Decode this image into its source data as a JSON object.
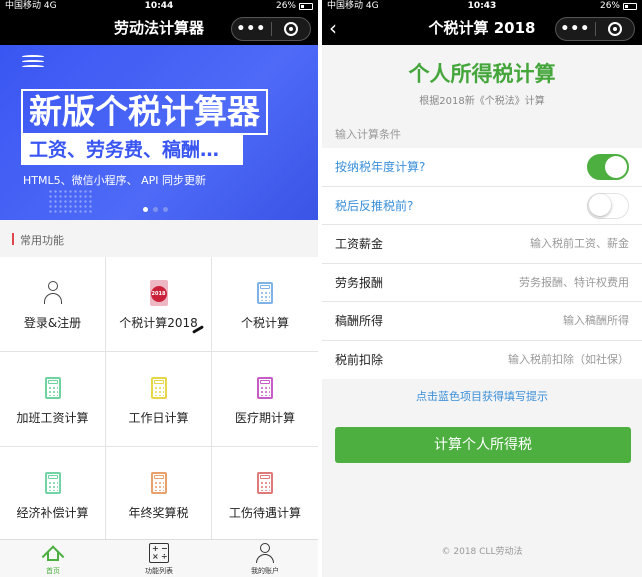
{
  "left": {
    "status": {
      "carrier": "中国移动  4G",
      "time": "10:44",
      "battery": "26%"
    },
    "nav": {
      "title": "劳动法计算器",
      "more": "•••"
    },
    "banner": {
      "headline": "新版个税计算器",
      "subline": "工资、劳务费、稿酬…",
      "tagline": "HTML5、微信小程序、 API 同步更新",
      "page_count": 3,
      "active_page": 1
    },
    "section_label": "常用功能",
    "grid": [
      {
        "label": "登录&注册",
        "icon": "user-icon",
        "color": "#444444"
      },
      {
        "label": "个税计算2018",
        "icon": "tax-2018-icon",
        "color": "#c9223a",
        "badge": "2018"
      },
      {
        "label": "个税计算",
        "icon": "calculator-icon",
        "color": "#7fb3e8"
      },
      {
        "label": "加班工资计算",
        "icon": "calculator-icon",
        "color": "#6fd3a0"
      },
      {
        "label": "工作日计算",
        "icon": "calculator-icon",
        "color": "#e6d74a"
      },
      {
        "label": "医疗期计算",
        "icon": "calculator-icon",
        "color": "#c75cc9"
      },
      {
        "label": "经济补偿计算",
        "icon": "calculator-icon",
        "color": "#72d4a4"
      },
      {
        "label": "年终奖算税",
        "icon": "calculator-icon",
        "color": "#e8a06c"
      },
      {
        "label": "工伤待遇计算",
        "icon": "calculator-icon",
        "color": "#e07a7a"
      }
    ],
    "tabs": [
      {
        "label": "首页",
        "icon": "home-icon",
        "active": true
      },
      {
        "label": "功能列表",
        "icon": "function-list-icon",
        "active": false
      },
      {
        "label": "我的账户",
        "icon": "account-icon",
        "active": false
      }
    ]
  },
  "right": {
    "status": {
      "carrier": "中国移动  4G",
      "time": "10:43",
      "battery": "26%"
    },
    "nav": {
      "title": "个税计算 2018",
      "more": "•••"
    },
    "title": "个人所得税计算",
    "subtitle": "根据2018新《个税法》计算",
    "conditions_label": "输入计算条件",
    "toggles": [
      {
        "label": "按纳税年度计算?",
        "on": true
      },
      {
        "label": "税后反推税前?",
        "on": false
      }
    ],
    "fields": [
      {
        "label": "工资薪金",
        "placeholder": "输入税前工资、薪金"
      },
      {
        "label": "劳务报酬",
        "placeholder": "劳务报酬、特许权费用"
      },
      {
        "label": "稿酬所得",
        "placeholder": "输入稿酬所得"
      },
      {
        "label": "税前扣除",
        "placeholder": "输入税前扣除（如社保）"
      }
    ],
    "hint": "点击蓝色项目获得填写提示",
    "submit": "计算个人所得税",
    "copyright": "© 2018 CLL劳动法"
  },
  "colors": {
    "accent_green": "#4caf3f",
    "link_blue": "#3a8fd9",
    "banner_blue": "#3a56f2",
    "section_bar_red": "#e0464a"
  }
}
